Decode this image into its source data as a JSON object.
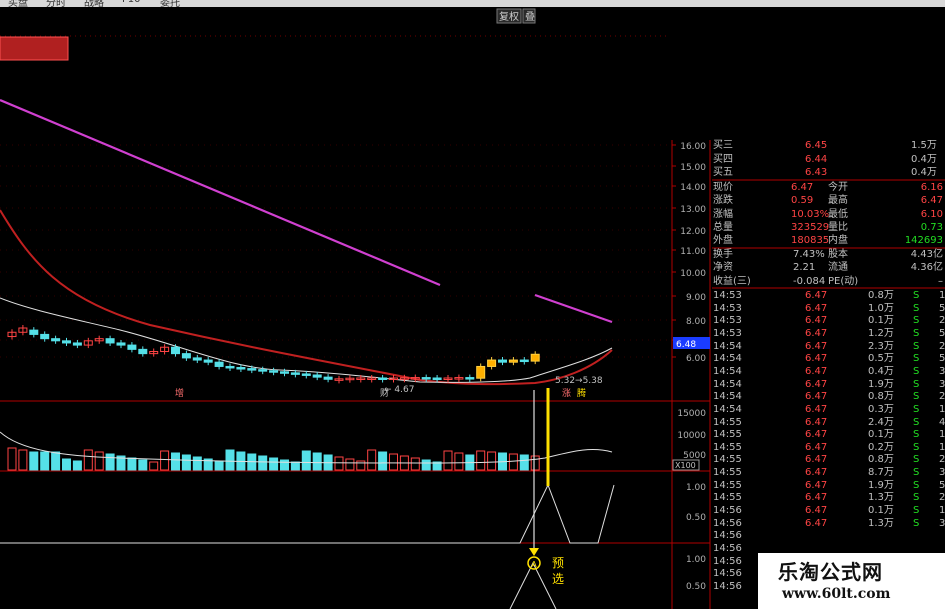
{
  "menu": {
    "items": [
      "买盘",
      "分时",
      "战略",
      "F10",
      "委托"
    ]
  },
  "toolbar": {
    "fuquan": "复权",
    "more": "叠"
  },
  "price_axis": {
    "ticks": [
      "16.00",
      "15.00",
      "14.00",
      "13.00",
      "12.00",
      "11.00",
      "10.00",
      "9.00",
      "8.00",
      "7.00",
      "6.00"
    ],
    "current": "6.48"
  },
  "volume_axis": {
    "ticks": [
      "15000",
      "10000",
      "5000"
    ],
    "unit": "X100"
  },
  "indicator_axis": {
    "ticks": [
      "1.00",
      "0.50"
    ]
  },
  "indicator2_axis": {
    "ticks": [
      "1.00",
      "0.50"
    ]
  },
  "annotations": {
    "low_label": "← 4.67",
    "range_label": "5.32→5.38",
    "event_a": "增",
    "event_b": "财",
    "event_c": "涨",
    "event_d": "腾",
    "signal_circle": "A",
    "signal_label": "预选"
  },
  "order_book": [
    {
      "label": "买三",
      "price": "6.45",
      "vol": "1.5万"
    },
    {
      "label": "买四",
      "price": "6.44",
      "vol": "0.4万"
    },
    {
      "label": "买五",
      "price": "6.43",
      "vol": "0.4万"
    }
  ],
  "quote": [
    {
      "l1": "现价",
      "v1": "6.47",
      "l2": "今开",
      "v2": "6.16",
      "c2": "#ff4444"
    },
    {
      "l1": "涨跌",
      "v1": "0.59",
      "l2": "最高",
      "v2": "6.47",
      "c2": "#ff4444"
    },
    {
      "l1": "涨幅",
      "v1": "10.03%",
      "l2": "最低",
      "v2": "6.10",
      "c2": "#ff4444"
    },
    {
      "l1": "总量",
      "v1": "323529",
      "l2": "量比",
      "v2": "0.73",
      "c2": "#22dd22"
    },
    {
      "l1": "外盘",
      "v1": "180835",
      "l2": "内盘",
      "v2": "142693",
      "c2": "#22dd22"
    }
  ],
  "fundamentals": [
    {
      "l1": "换手",
      "v1": "7.43%",
      "l2": "股本",
      "v2": "4.43亿"
    },
    {
      "l1": "净资",
      "v1": "2.21",
      "l2": "流通",
      "v2": "4.36亿"
    },
    {
      "l1": "收益(三)",
      "v1": "-0.084",
      "l2": "PE(动)",
      "v2": "–"
    }
  ],
  "trades": [
    {
      "time": "14:53",
      "price": "6.47",
      "vol": "0.8万",
      "side": "S",
      "n": "1"
    },
    {
      "time": "14:53",
      "price": "6.47",
      "vol": "1.0万",
      "side": "S",
      "n": "5"
    },
    {
      "time": "14:53",
      "price": "6.47",
      "vol": "0.1万",
      "side": "S",
      "n": "2"
    },
    {
      "time": "14:53",
      "price": "6.47",
      "vol": "1.2万",
      "side": "S",
      "n": "5"
    },
    {
      "time": "14:54",
      "price": "6.47",
      "vol": "2.3万",
      "side": "S",
      "n": "2"
    },
    {
      "time": "14:54",
      "price": "6.47",
      "vol": "0.5万",
      "side": "S",
      "n": "5"
    },
    {
      "time": "14:54",
      "price": "6.47",
      "vol": "0.4万",
      "side": "S",
      "n": "3"
    },
    {
      "time": "14:54",
      "price": "6.47",
      "vol": "1.9万",
      "side": "S",
      "n": "3"
    },
    {
      "time": "14:54",
      "price": "6.47",
      "vol": "0.8万",
      "side": "S",
      "n": "2"
    },
    {
      "time": "14:54",
      "price": "6.47",
      "vol": "0.3万",
      "side": "S",
      "n": "1"
    },
    {
      "time": "14:55",
      "price": "6.47",
      "vol": "2.4万",
      "side": "S",
      "n": "4"
    },
    {
      "time": "14:55",
      "price": "6.47",
      "vol": "0.1万",
      "side": "S",
      "n": "1"
    },
    {
      "time": "14:55",
      "price": "6.47",
      "vol": "0.2万",
      "side": "S",
      "n": "1"
    },
    {
      "time": "14:55",
      "price": "6.47",
      "vol": "0.8万",
      "side": "S",
      "n": "2"
    },
    {
      "time": "14:55",
      "price": "6.47",
      "vol": "8.7万",
      "side": "S",
      "n": "3"
    },
    {
      "time": "14:55",
      "price": "6.47",
      "vol": "1.9万",
      "side": "S",
      "n": "5"
    },
    {
      "time": "14:55",
      "price": "6.47",
      "vol": "1.3万",
      "side": "S",
      "n": "2"
    },
    {
      "time": "14:56",
      "price": "6.47",
      "vol": "0.1万",
      "side": "S",
      "n": "1"
    },
    {
      "time": "14:56",
      "price": "6.47",
      "vol": "1.3万",
      "side": "S",
      "n": "3"
    },
    {
      "time": "14:56",
      "price": "",
      "vol": "",
      "side": "",
      "n": ""
    },
    {
      "time": "14:56",
      "price": "",
      "vol": "",
      "side": "",
      "n": ""
    },
    {
      "time": "14:56",
      "price": "",
      "vol": "",
      "side": "",
      "n": ""
    },
    {
      "time": "14:56",
      "price": "",
      "vol": "",
      "side": "",
      "n": ""
    },
    {
      "time": "14:56",
      "price": "",
      "vol": "",
      "side": "",
      "n": ""
    }
  ],
  "watermark": {
    "title": "乐淘公式网",
    "url": "www.60lt.com"
  },
  "colors": {
    "up": "#ff4444",
    "down": "#55e0e8",
    "ma_long": "#d040d0",
    "ma_mid": "#c02020",
    "ma_short": "#e0e0e0",
    "signal": "#ffe000",
    "axis": "#b00000"
  },
  "chart_data": {
    "type": "candlestick",
    "price_unit": "元",
    "price_ylim": [
      5.5,
      16.5
    ],
    "candles": [
      {
        "o": 7.3,
        "c": 7.5
      },
      {
        "o": 7.5,
        "c": 7.7
      },
      {
        "o": 7.6,
        "c": 7.4
      },
      {
        "o": 7.4,
        "c": 7.2
      },
      {
        "o": 7.2,
        "c": 7.1
      },
      {
        "o": 7.1,
        "c": 7.0
      },
      {
        "o": 7.0,
        "c": 6.9
      },
      {
        "o": 6.9,
        "c": 7.1
      },
      {
        "o": 7.1,
        "c": 7.2
      },
      {
        "o": 7.2,
        "c": 7.0
      },
      {
        "o": 7.0,
        "c": 6.9
      },
      {
        "o": 6.9,
        "c": 6.7
      },
      {
        "o": 6.7,
        "c": 6.5
      },
      {
        "o": 6.5,
        "c": 6.6
      },
      {
        "o": 6.6,
        "c": 6.8
      },
      {
        "o": 6.8,
        "c": 6.5
      },
      {
        "o": 6.5,
        "c": 6.3
      },
      {
        "o": 6.3,
        "c": 6.2
      },
      {
        "o": 6.2,
        "c": 6.1
      },
      {
        "o": 6.1,
        "c": 5.9
      },
      {
        "o": 5.9,
        "c": 5.85
      },
      {
        "o": 5.85,
        "c": 5.8
      },
      {
        "o": 5.8,
        "c": 5.75
      },
      {
        "o": 5.75,
        "c": 5.7
      },
      {
        "o": 5.7,
        "c": 5.65
      },
      {
        "o": 5.65,
        "c": 5.6
      },
      {
        "o": 5.6,
        "c": 5.55
      },
      {
        "o": 5.55,
        "c": 5.5
      },
      {
        "o": 5.5,
        "c": 5.4
      },
      {
        "o": 5.4,
        "c": 5.3
      },
      {
        "o": 5.3,
        "c": 5.32
      },
      {
        "o": 5.32,
        "c": 5.35
      },
      {
        "o": 5.35,
        "c": 5.36
      },
      {
        "o": 5.36,
        "c": 5.36
      },
      {
        "o": 5.36,
        "c": 5.35
      },
      {
        "o": 5.35,
        "c": 5.36
      },
      {
        "o": 5.36,
        "c": 5.37
      },
      {
        "o": 5.37,
        "c": 5.38
      },
      {
        "o": 5.38,
        "c": 5.36
      },
      {
        "o": 5.36,
        "c": 5.35
      },
      {
        "o": 5.35,
        "c": 5.36
      },
      {
        "o": 5.36,
        "c": 5.38
      },
      {
        "o": 5.38,
        "c": 5.35
      },
      {
        "o": 5.35,
        "c": 5.9
      },
      {
        "o": 5.9,
        "c": 6.2
      },
      {
        "o": 6.2,
        "c": 6.1
      },
      {
        "o": 6.1,
        "c": 6.2
      },
      {
        "o": 6.2,
        "c": 6.15
      },
      {
        "o": 6.15,
        "c": 6.47
      }
    ]
  }
}
